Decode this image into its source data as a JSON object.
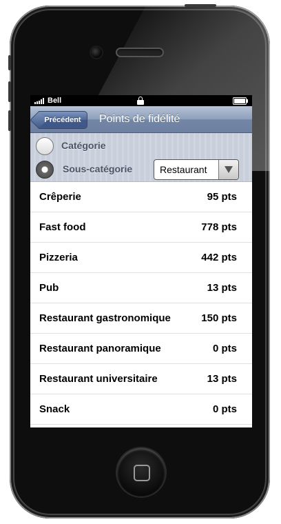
{
  "statusbar": {
    "carrier": "Bell",
    "signal_bars": 5,
    "battery_level": 1.0
  },
  "navbar": {
    "back_label": "Précédent",
    "title": "Points de fidélité"
  },
  "filter": {
    "option_category": "Catégorie",
    "option_subcategory": "Sous-catégorie",
    "selected": "subcategory",
    "dropdown_value": "Restaurant"
  },
  "list": {
    "items": [
      {
        "name": "Crêperie",
        "points": "95 pts"
      },
      {
        "name": "Fast food",
        "points": "778 pts"
      },
      {
        "name": "Pizzeria",
        "points": "442 pts"
      },
      {
        "name": "Pub",
        "points": "13 pts"
      },
      {
        "name": "Restaurant gastronomique",
        "points": "150 pts"
      },
      {
        "name": "Restaurant panoramique",
        "points": "0 pts"
      },
      {
        "name": "Restaurant universitaire",
        "points": "13 pts"
      },
      {
        "name": "Snack",
        "points": "0 pts"
      }
    ]
  },
  "colors": {
    "navbar": "#7386a6",
    "back_button": "#41598a",
    "filter_bg": "#c8ceda"
  }
}
